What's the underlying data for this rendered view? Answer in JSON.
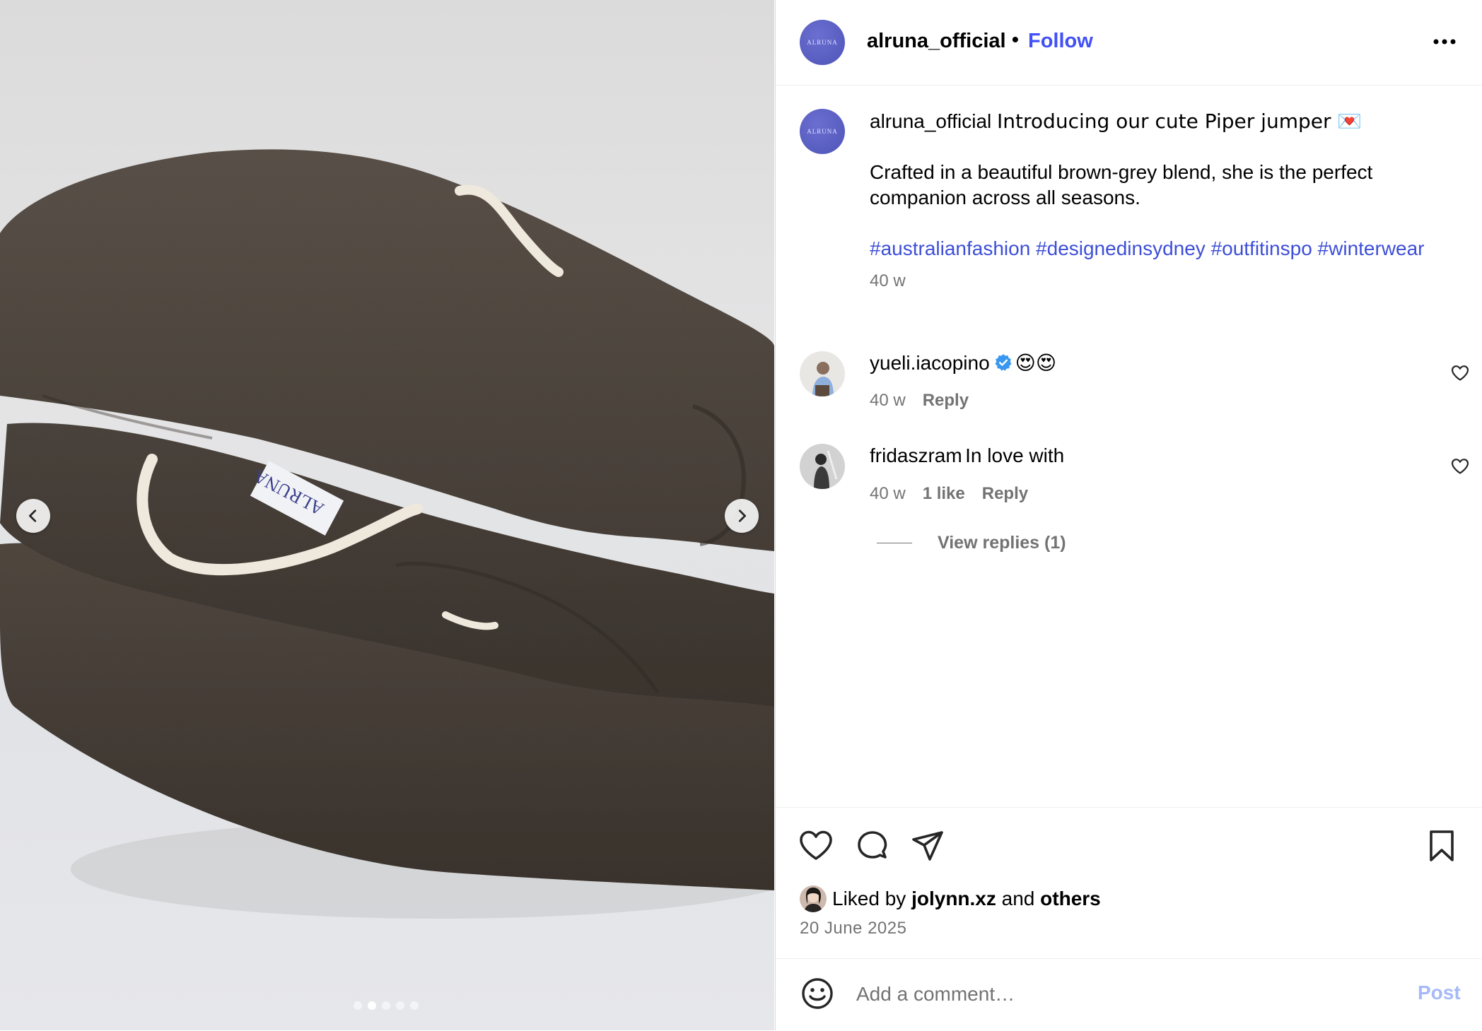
{
  "post": {
    "username": "alruna_official",
    "header_separator": "•",
    "follow_label": "Follow",
    "avatar_text": "ALRUNA",
    "carousel": {
      "dot_count": 5,
      "active_index": 1
    }
  },
  "caption": {
    "username": "alruna_official",
    "text": "Introducing our cute Piper jumper 💌",
    "body": "Crafted in a beautiful brown-grey blend, she is the perfect companion across all seasons.",
    "hashtags": "#australianfashion #designedinsydney #outfitinspo #winterwear",
    "time": "40 w"
  },
  "comments": [
    {
      "username": "yueli.iacopino",
      "verified": true,
      "text": "😍😍",
      "time": "40 w",
      "reply_label": "Reply"
    },
    {
      "username": "fridaszram",
      "verified": false,
      "text": "In love with",
      "time": "40 w",
      "likes": "1 like",
      "reply_label": "Reply",
      "view_replies": "View replies (1)"
    }
  ],
  "likes": {
    "prefix": "Liked by",
    "user": "jolynn.xz",
    "conj": "and",
    "others": "others"
  },
  "date": "20 June 2025",
  "comment_box": {
    "placeholder": "Add a comment…",
    "post_label": "Post"
  },
  "colors": {
    "link_blue": "#4150f7",
    "hashtag_blue": "#3d4ed8",
    "meta_grey": "#737373",
    "post_disabled": "#a6b9f9"
  }
}
